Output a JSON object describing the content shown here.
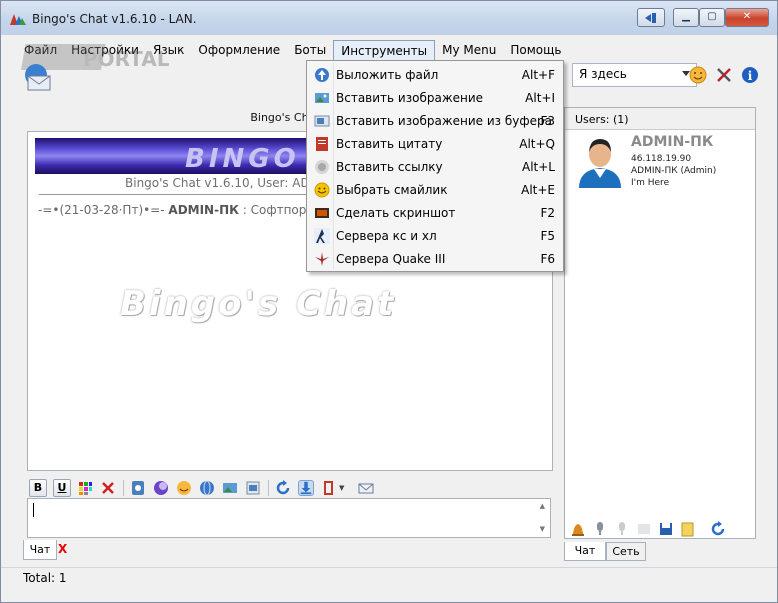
{
  "window": {
    "title": "Bingo's Chat v1.6.10 - LAN."
  },
  "menu": [
    "Файл",
    "Настройки",
    "Язык",
    "Оформление",
    "Боты",
    "Инструменты",
    "My Menu",
    "Помощь"
  ],
  "toolbar": {
    "status_value": "Я здесь"
  },
  "chat": {
    "header": "Bingo's Chat v",
    "banner_text": "BINGO C",
    "version_line": "Bingo's Chat v1.6.10, User: AD",
    "message_prefix": "-=•(21-03-28·Пт)•=- ",
    "message_user": "ADMIN-ПК",
    "message_text": " : Софтпортал!",
    "watermark": "Bingo's Chat"
  },
  "format_toolbar": {
    "bold": "B",
    "underline": "U"
  },
  "bottom_tabs": {
    "chat": "Чат",
    "close": "X"
  },
  "users": {
    "header": "Users: (1)",
    "name": "ADMIN-ПК",
    "ip": "46.118.19.90",
    "host": "ADMIN-ПК (Admin)",
    "status": "I'm Here"
  },
  "right_tabs": {
    "chat": "Чат",
    "network": "Сеть"
  },
  "statusbar": {
    "total": "Total: 1"
  },
  "dropdown": [
    {
      "label": "Выложить файл",
      "shortcut": "Alt+F",
      "icon": "upload-file-icon",
      "color": "#3a78c9"
    },
    {
      "label": "Вставить изображение",
      "shortcut": "Alt+I",
      "icon": "insert-image-icon",
      "color": "#3b8a3e"
    },
    {
      "label": "Вставить изображение из буфера",
      "shortcut": "F3",
      "icon": "clipboard-image-icon",
      "color": "#4a7fbf"
    },
    {
      "label": "Вставить цитату",
      "shortcut": "Alt+Q",
      "icon": "quote-icon",
      "color": "#c0392b"
    },
    {
      "label": "Вставить ссылку",
      "shortcut": "Alt+L",
      "icon": "link-icon",
      "color": "#9e9e9e"
    },
    {
      "label": "Выбрать смайлик",
      "shortcut": "Alt+E",
      "icon": "smiley-icon",
      "color": "#f5c400"
    },
    {
      "label": "Сделать скриншот",
      "shortcut": "F2",
      "icon": "screenshot-icon",
      "color": "#b5451b"
    },
    {
      "label": "Сервера кс и хл",
      "shortcut": "F5",
      "icon": "counter-strike-icon",
      "color": "#2d4f8a"
    },
    {
      "label": "Сервера Quake III",
      "shortcut": "F6",
      "icon": "quake-icon",
      "color": "#a52a2a"
    }
  ],
  "colors": {
    "accent": "#3a78c9",
    "close_button": "#c7432c"
  }
}
